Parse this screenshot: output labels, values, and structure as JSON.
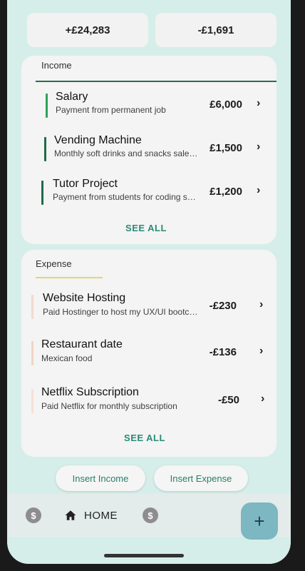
{
  "summary": {
    "income_total": "+£24,283",
    "expense_total": "-£1,691"
  },
  "income": {
    "title": "Income",
    "accent": "#2e9e5b",
    "items": [
      {
        "title": "Salary",
        "subtitle": "Payment from permanent job",
        "amount": "£6,000",
        "bar_color": "#2ea35a"
      },
      {
        "title": "Vending Machine",
        "subtitle": "Monthly soft drinks and snacks sales i...",
        "amount": "£1,500",
        "bar_color": "#1f6b4a"
      },
      {
        "title": "Tutor Project",
        "subtitle": "Payment from students for coding ses...",
        "amount": "£1,200",
        "bar_color": "#1f6b4a"
      }
    ],
    "see_all": "SEE ALL"
  },
  "expense": {
    "title": "Expense",
    "accent": "#e8d27a",
    "items": [
      {
        "title": "Website Hosting",
        "subtitle": "Paid Hostinger to host my UX/UI bootca...",
        "amount": "-£230",
        "bar_color": "#f3d9cf"
      },
      {
        "title": "Restaurant date",
        "subtitle": "Mexican food",
        "amount": "-£136",
        "bar_color": "#f3d4c2"
      },
      {
        "title": "Netflix Subscription",
        "subtitle": "Paid Netflix for monthly subscription",
        "amount": "-£50",
        "bar_color": "#f6e0d6"
      }
    ],
    "see_all": "SEE ALL"
  },
  "actions": {
    "insert_income": "Insert Income",
    "insert_expense": "Insert Expense"
  },
  "nav": {
    "home_label": "HOME",
    "left_icon": "dollar-coin-icon",
    "home_icon": "home-icon",
    "right_icon": "dollar-coin-icon",
    "fab": "+"
  }
}
